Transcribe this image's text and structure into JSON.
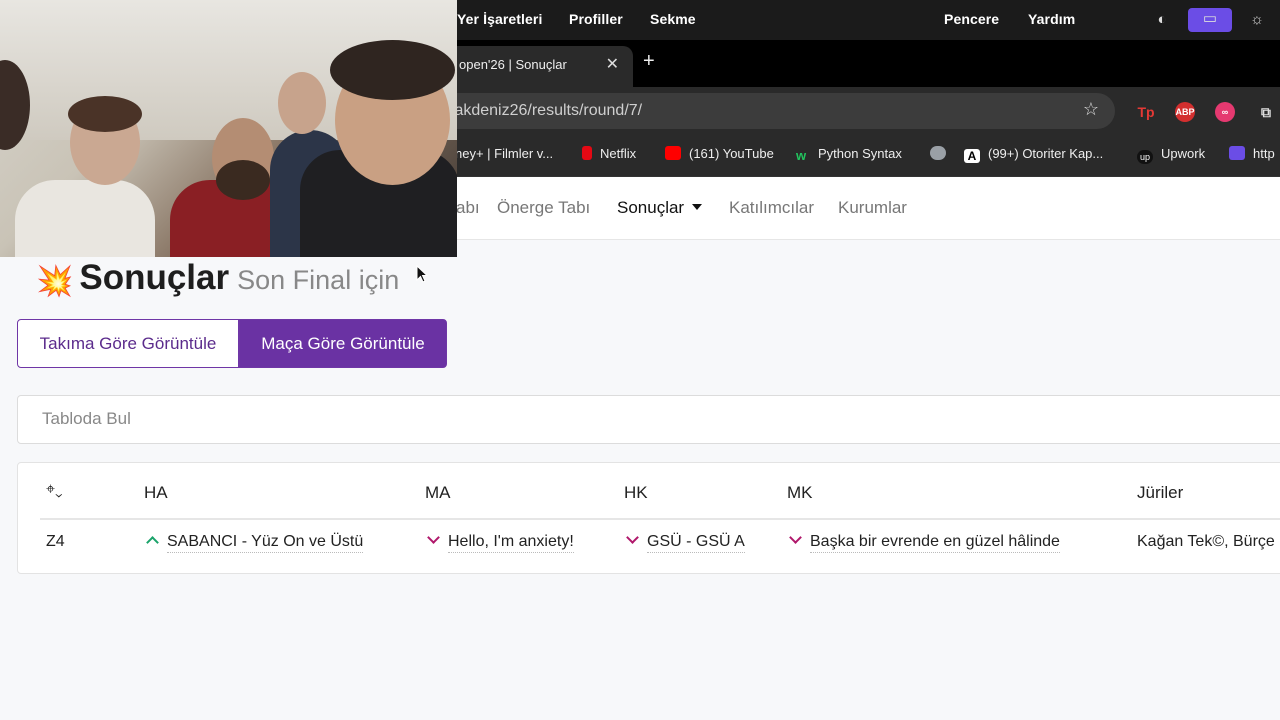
{
  "menubar": {
    "items": [
      "Yer İşaretleri",
      "Profiller",
      "Sekme",
      "Pencere",
      "Yardım"
    ]
  },
  "tab": {
    "title": "open'26 | Sonuçlar",
    "close": "✕"
  },
  "newtab": "+",
  "toolbar": {
    "url": "/akdeniz26/results/round/7/"
  },
  "bookmarks": [
    {
      "label": "ney+ | Filmler v...",
      "color": "#2a2a2a"
    },
    {
      "label": "Netflix",
      "color": "#e50914"
    },
    {
      "label": "(161) YouTube",
      "color": "#ff0000"
    },
    {
      "label": "Python Syntax",
      "color": "#22c55e"
    },
    {
      "label": "",
      "color": "#9aa0a6"
    },
    {
      "label": "(99+) Otoriter Kap...",
      "color": "#ffffff"
    },
    {
      "label": "Upwork",
      "color": "#111111"
    },
    {
      "label": "http",
      "color": "#6b4de6"
    }
  ],
  "nav": {
    "items": [
      "abı",
      "Önerge Tabı",
      "Sonuçlar",
      "Katılımcılar",
      "Kurumlar"
    ]
  },
  "page": {
    "title": "Sonuçlar",
    "subtitle": "Son Final için",
    "view_by_team": "Takıma Göre Görüntüle",
    "view_by_debate": "Maça Göre Görüntüle",
    "search_placeholder": "Tabloda Bul"
  },
  "table": {
    "headers": [
      "HA",
      "MA",
      "HK",
      "MK",
      "Jüriler"
    ],
    "rows": [
      {
        "venue": "Z4",
        "ha": "SABANCI - Yüz On ve Üstü",
        "ma": "Hello, I'm anxiety!",
        "hk": "GSÜ - GSÜ A",
        "mk": "Başka bir evrende en güzel hâlinde",
        "judges": "Kağan Tek©, Bürçe"
      }
    ]
  },
  "colors": {
    "accent": "#6a32a3",
    "up": "#1aa36a",
    "down": "#b0186b"
  }
}
